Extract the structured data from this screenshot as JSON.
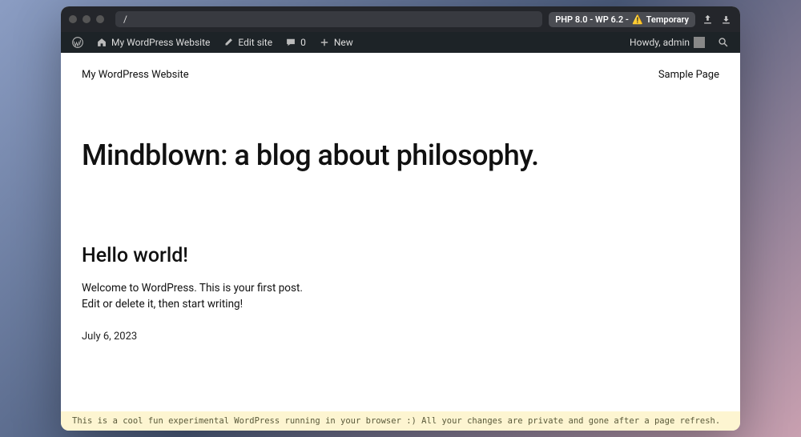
{
  "titlebar": {
    "url_path": "/",
    "php_badge": "PHP 8.0 - WP 6.2 - ",
    "php_badge_tail": "Temporary"
  },
  "adminbar": {
    "site_name": "My WordPress Website",
    "edit_site": "Edit site",
    "comments_count": "0",
    "new_label": "New",
    "greeting": "Howdy, admin"
  },
  "site": {
    "title": "My WordPress Website",
    "nav_item": "Sample Page"
  },
  "blog": {
    "heading": "Mindblown: a blog about philosophy."
  },
  "post": {
    "title": "Hello world!",
    "body_line1": "Welcome to WordPress. This is your first post.",
    "body_line2": "Edit or delete it, then start writing!",
    "date": "July 6, 2023"
  },
  "footer": {
    "note": "This is a cool fun experimental WordPress running in your browser :) All your changes are private and gone after a page refresh."
  }
}
